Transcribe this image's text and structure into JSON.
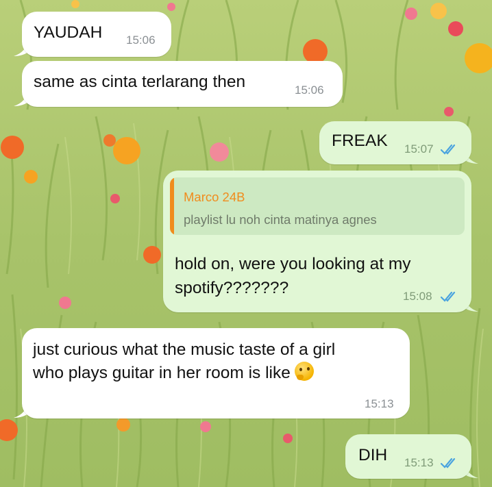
{
  "colors": {
    "incoming_bubble": "#ffffff",
    "outgoing_bubble": "#e1f7d5",
    "reply_accent": "#f08c1d",
    "read_ticks": "#4aa3df"
  },
  "messages": [
    {
      "id": "m1",
      "direction": "incoming",
      "text": "YAUDAH",
      "time": "15:06"
    },
    {
      "id": "m2",
      "direction": "incoming",
      "text": "same as cinta terlarang then",
      "time": "15:06"
    },
    {
      "id": "m3",
      "direction": "outgoing",
      "text": "FREAK",
      "time": "15:07",
      "status": "read-double-check-icon"
    },
    {
      "id": "m4",
      "direction": "outgoing",
      "reply": {
        "author": "Marco 24B",
        "text": "playlist lu noh cinta matinya agnes"
      },
      "text_line1": "hold on, were you looking at my",
      "text_line2": "spotify???????",
      "time": "15:08",
      "status": "read-double-check-icon"
    },
    {
      "id": "m5",
      "direction": "incoming",
      "text_line1": "just curious what the music taste of a girl",
      "text_line2": "who plays guitar in her room is like",
      "emoji": "thinking-face-icon",
      "time": "15:13"
    },
    {
      "id": "m6",
      "direction": "outgoing",
      "text": "DIH",
      "time": "15:13",
      "status": "read-double-check-icon"
    }
  ]
}
